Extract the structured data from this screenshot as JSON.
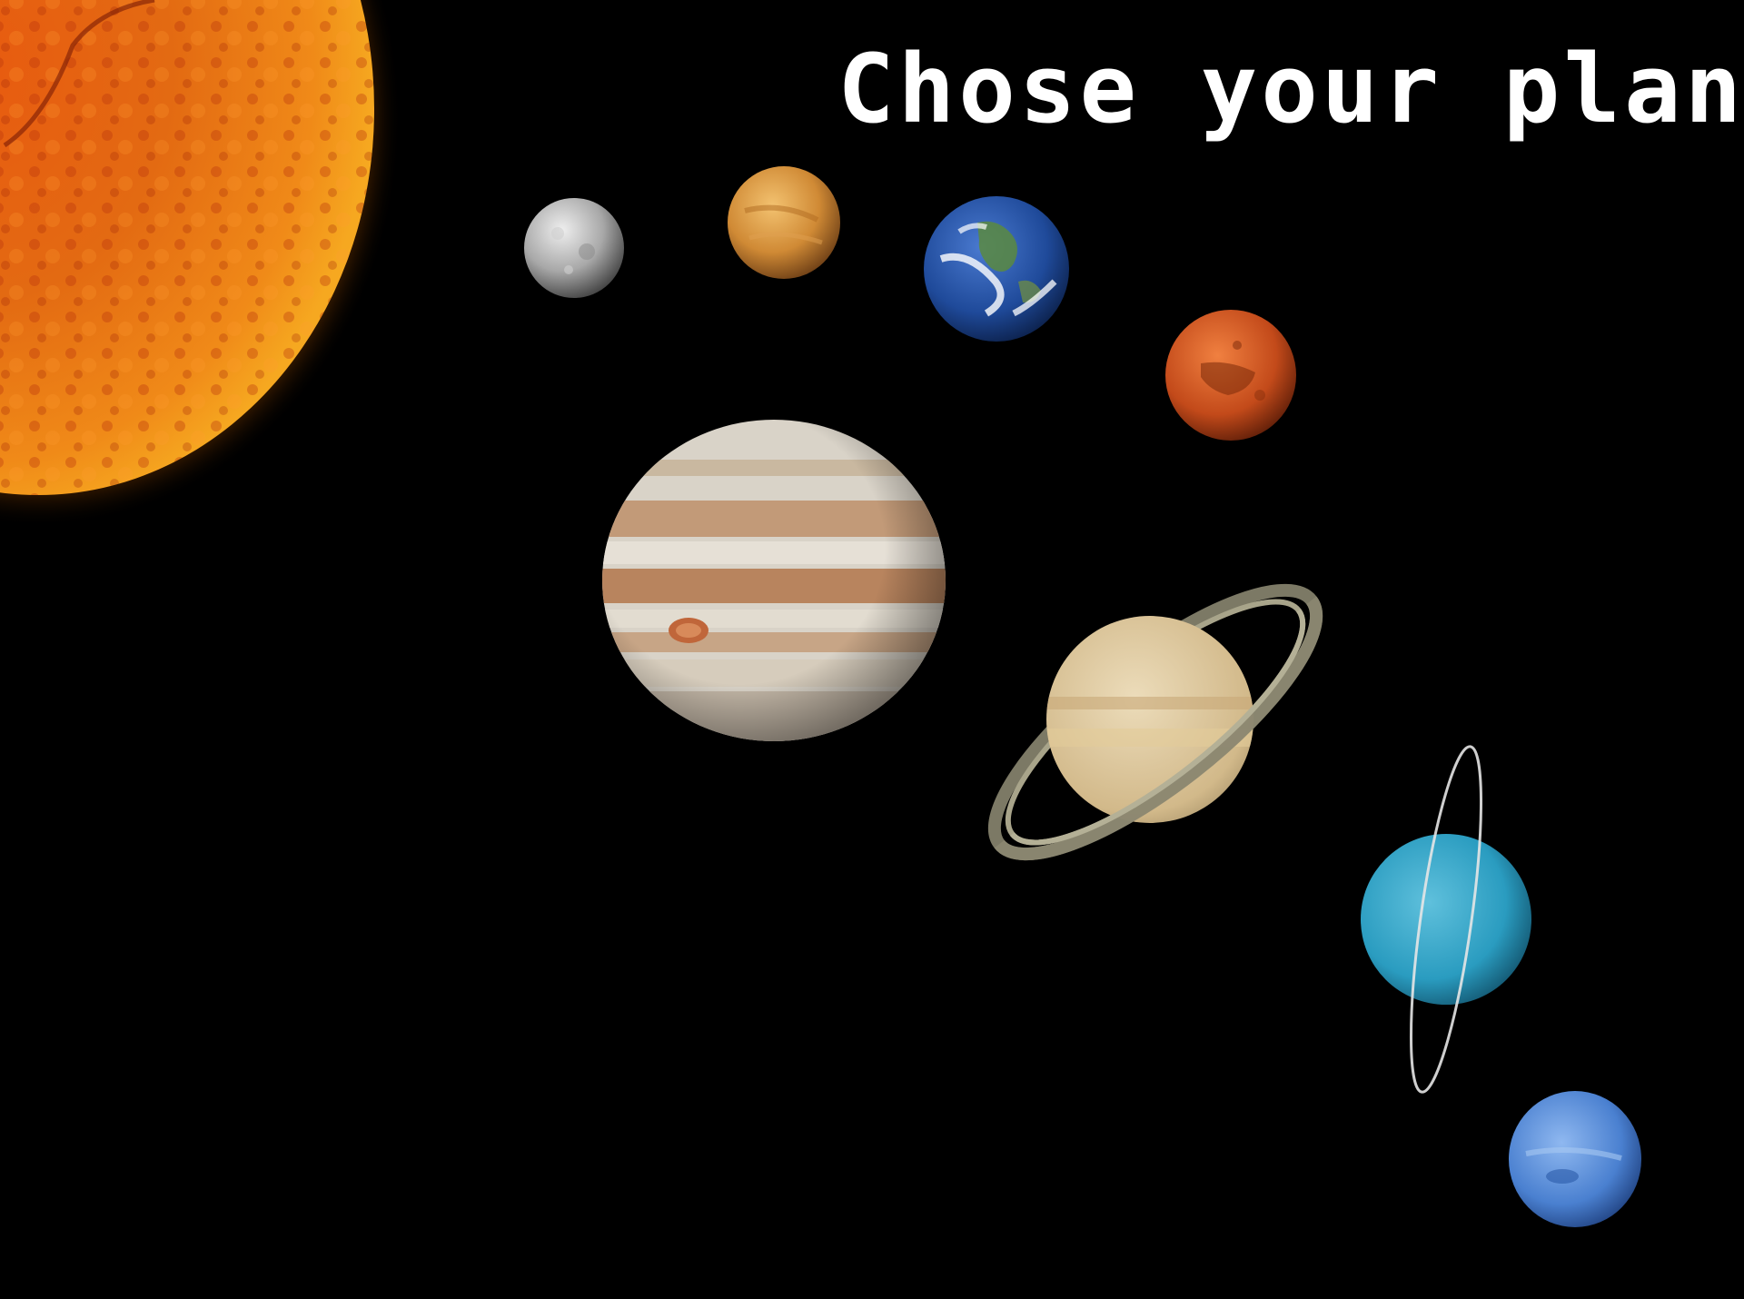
{
  "title": "Chose your planet",
  "colors": {
    "background": "#000000",
    "title": "#ffffff",
    "sun": "#f07a10"
  },
  "bodies": [
    {
      "id": "sun",
      "icon": "sun-icon"
    },
    {
      "id": "mercury",
      "icon": "mercury-icon"
    },
    {
      "id": "venus",
      "icon": "venus-icon"
    },
    {
      "id": "earth",
      "icon": "earth-icon"
    },
    {
      "id": "mars",
      "icon": "mars-icon"
    },
    {
      "id": "jupiter",
      "icon": "jupiter-icon"
    },
    {
      "id": "saturn",
      "icon": "saturn-icon"
    },
    {
      "id": "uranus",
      "icon": "uranus-icon"
    },
    {
      "id": "neptune",
      "icon": "neptune-icon"
    }
  ]
}
